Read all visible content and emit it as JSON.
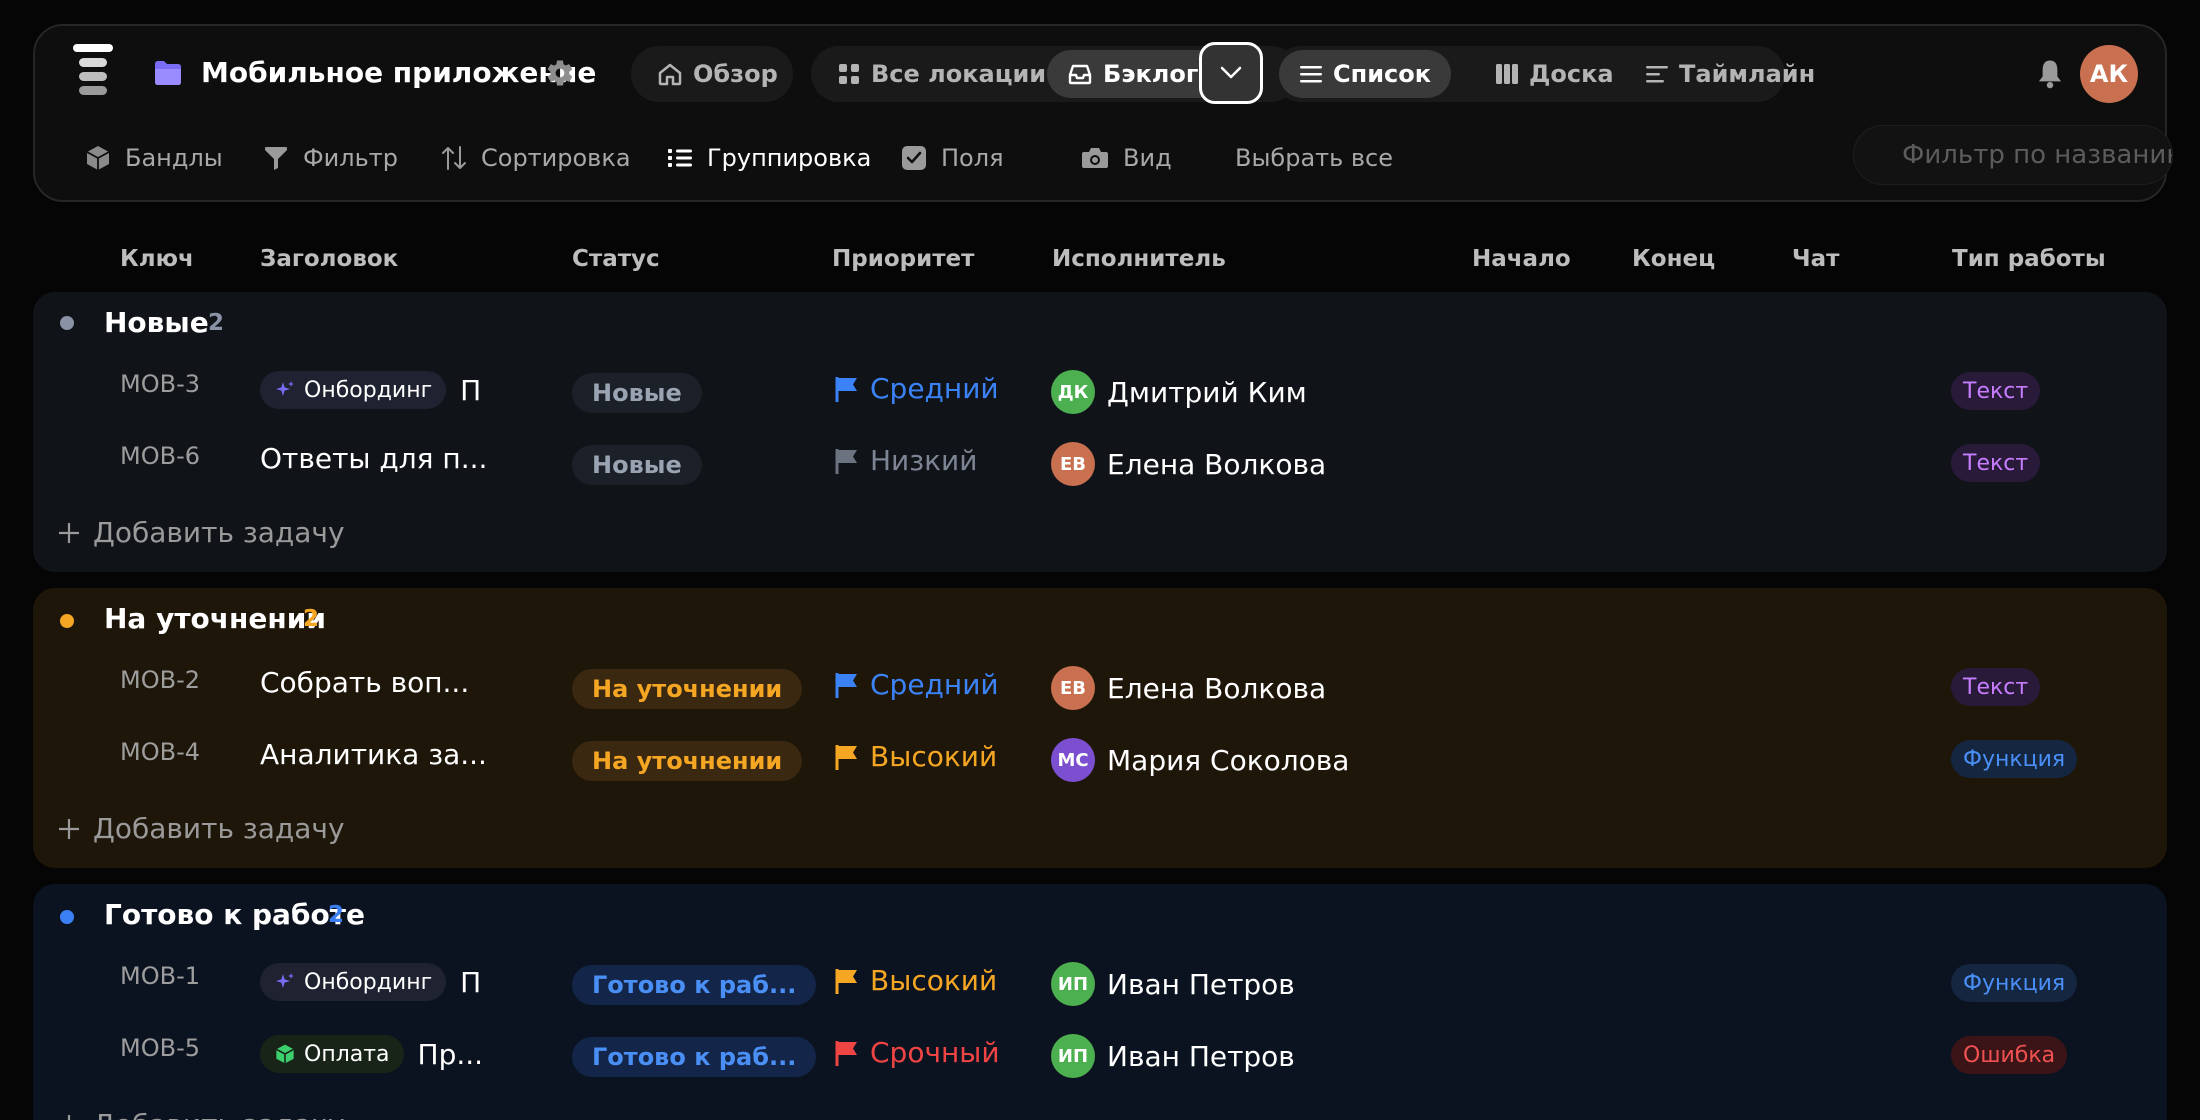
{
  "header": {
    "project_title": "Мобильное приложение",
    "nav": {
      "overview": "Обзор",
      "all_locations": "Все локации",
      "backlog": "Бэклог",
      "list": "Список",
      "board": "Доска",
      "timeline": "Таймлайн"
    },
    "avatar_initials": "АК",
    "toolbar": {
      "bundles": "Бандлы",
      "filter": "Фильтр",
      "sort": "Сортировка",
      "grouping": "Группировка",
      "fields": "Поля",
      "view": "Вид",
      "select_all": "Выбрать все"
    },
    "search_placeholder": "Фильтр по названию"
  },
  "columns": {
    "key": "Ключ",
    "title": "Заголовок",
    "status": "Статус",
    "priority": "Приоритет",
    "assignee": "Исполнитель",
    "start": "Начало",
    "end": "Конец",
    "chat": "Чат",
    "work_type": "Тип работы"
  },
  "add_task_label": "Добавить задачу",
  "groups": [
    {
      "name": "Новые",
      "count": "2",
      "color": "#8a93a6",
      "rows": [
        {
          "key": "MOB-3",
          "tag": "Онбординг",
          "tag_icon": "sparkles-icon",
          "title": "П",
          "status": "Новые",
          "priority": "Средний",
          "assignee_initials": "ДК",
          "assignee": "Дмитрий Ким",
          "work_type": "Текст"
        },
        {
          "key": "MOB-6",
          "tag": "",
          "title": "Ответы для п...",
          "status": "Новые",
          "priority": "Низкий",
          "assignee_initials": "ЕВ",
          "assignee": "Елена Волкова",
          "work_type": "Текст"
        }
      ]
    },
    {
      "name": "На уточнении",
      "count": "2",
      "color": "#f5a623",
      "rows": [
        {
          "key": "MOB-2",
          "tag": "",
          "title": "Собрать воп...",
          "status": "На уточнении",
          "priority": "Средний",
          "assignee_initials": "ЕВ",
          "assignee": "Елена Волкова",
          "work_type": "Текст"
        },
        {
          "key": "MOB-4",
          "tag": "",
          "title": "Аналитика за...",
          "status": "На уточнении",
          "priority": "Высокий",
          "assignee_initials": "МС",
          "assignee": "Мария Соколова",
          "work_type": "Функция"
        }
      ]
    },
    {
      "name": "Готово к работе",
      "count": "2",
      "color": "#3b7ff5",
      "rows": [
        {
          "key": "MOB-1",
          "tag": "Онбординг",
          "tag_icon": "sparkles-icon",
          "title": "П",
          "status": "Готово к раб...",
          "priority": "Высокий",
          "assignee_initials": "ИП",
          "assignee": "Иван Петров",
          "work_type": "Функция"
        },
        {
          "key": "MOB-5",
          "tag": "Оплата",
          "tag_icon": "cube-icon",
          "title": "Пр...",
          "status": "Готово к раб...",
          "priority": "Срочный",
          "assignee_initials": "ИП",
          "assignee": "Иван Петров",
          "work_type": "Ошибка"
        }
      ]
    }
  ]
}
